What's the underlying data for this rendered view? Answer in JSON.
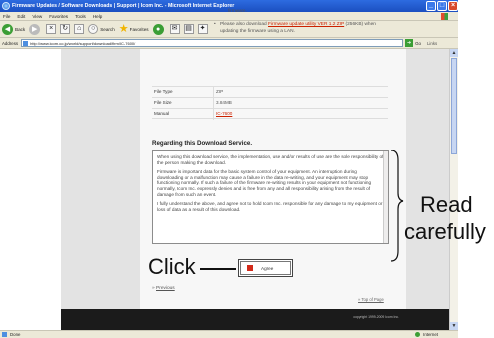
{
  "window": {
    "title": "Firmware Updates / Software Downloads | Support | Icom Inc. - Microsoft Internet Explorer",
    "controls": [
      "_",
      "□",
      "×"
    ]
  },
  "menu": [
    "File",
    "Edit",
    "View",
    "Favorites",
    "Tools",
    "Help"
  ],
  "toolbar": {
    "back": "Back",
    "search": "Search",
    "favorites": "Favorites"
  },
  "address": {
    "label": "Address",
    "url": "http://www.icom.co.jp/world/support/download/firm/IC-7600/",
    "go": "Go",
    "links": "Links"
  },
  "page": {
    "top_text": "firmware.",
    "bullet_prefix": "Please also download ",
    "bullet_link": "Firmware update utility VER 1.2 ZIP",
    "bullet_suffix": " (256KB) when updating the firmware using a LAN.",
    "specs": [
      {
        "key": "File Type",
        "value": "ZIP",
        "link": false
      },
      {
        "key": "File Size",
        "value": "3.84MB",
        "link": false
      },
      {
        "key": "Manual",
        "value": "IC-7600",
        "link": true
      }
    ],
    "section_title": "Regarding this Download Service.",
    "terms": [
      "When using this download service, the implementation, use and/or results of use are the sole responsibility of the person making the download.",
      "Firmware is important data for the basic system control of your equipment. An interruption during downloading or a malfunction may cause a failure in the data re-writing, and your equipment may stop functioning normally. If such a failure of the firmware re-writing results in your equipment not functioning normally, Icom Inc. expressly denies and is free from any and all responsibility arising from the result of damage from such an event.",
      "I fully understand the above, and agree not to hold Icom Inc. responsible for any damage to my equipment or loss of data as a result of this download."
    ],
    "agree_button": "Agree",
    "previous_arrow": "»",
    "previous": "Previous",
    "top_of_page": "» Top of Page",
    "copyright": "copyright 1999-2009 Icom Inc."
  },
  "status": {
    "done": "Done",
    "zone": "Internet"
  },
  "annotations": {
    "read_line1": "Read",
    "read_line2": "carefully",
    "click": "Click"
  }
}
